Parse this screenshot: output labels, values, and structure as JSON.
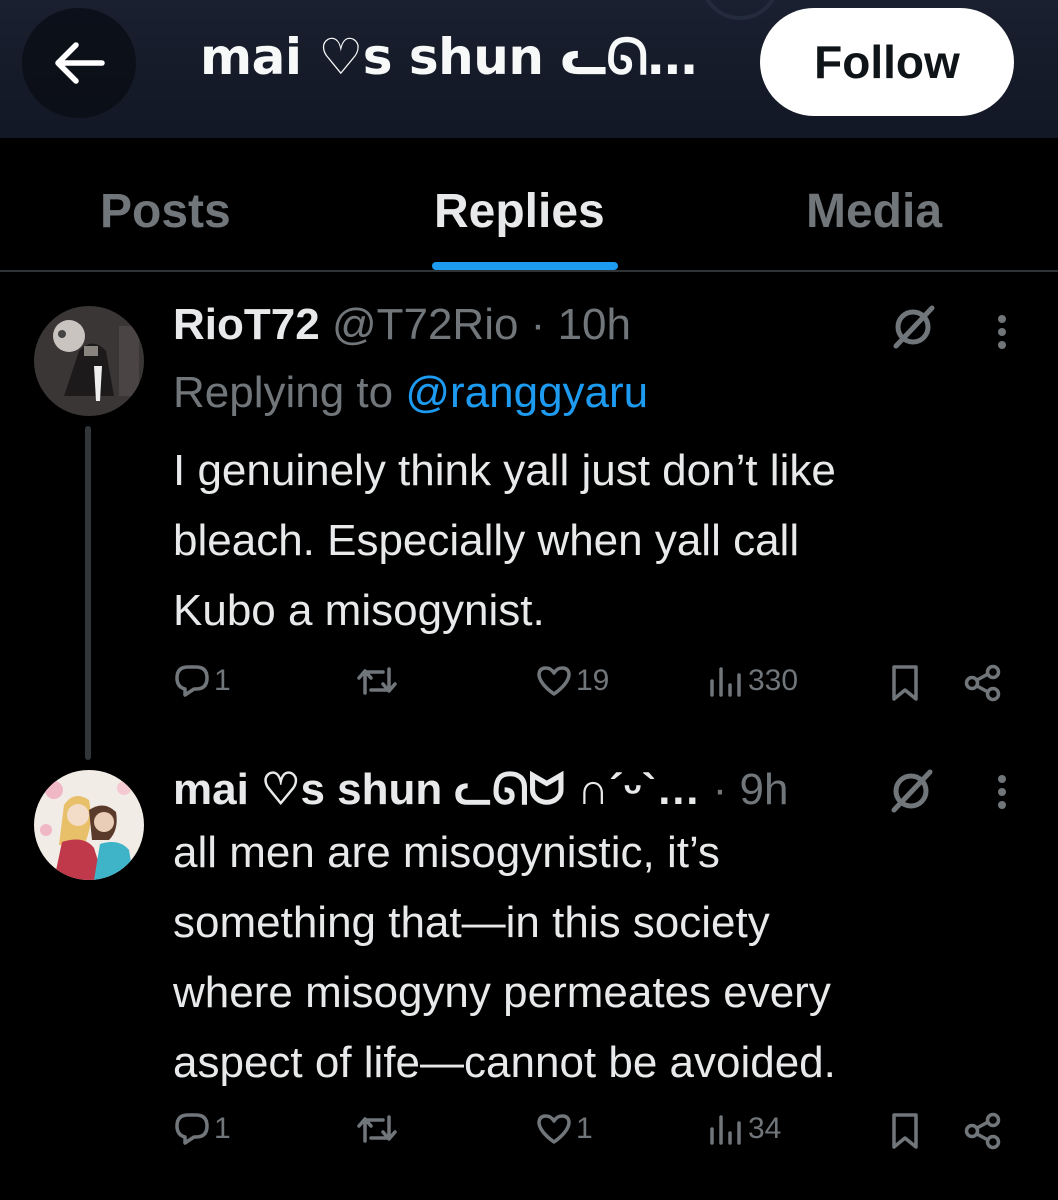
{
  "header": {
    "title": "mai ♡s shun ᓚᘏ…",
    "follow_label": "Follow",
    "back_icon": "arrow-left-icon"
  },
  "tabs": [
    {
      "label": "Posts",
      "active": false
    },
    {
      "label": "Replies",
      "active": true
    },
    {
      "label": "Media",
      "active": false
    }
  ],
  "colors": {
    "accent": "#1d9bf0",
    "background": "#000000",
    "muted": "#71767b"
  },
  "posts": [
    {
      "author_name": "RioT72",
      "handle": "@T72Rio",
      "separator": " · ",
      "time": "10h",
      "replying_prefix": "Replying to ",
      "replying_to": "@ranggyaru",
      "lines": [
        "I genuinely think yall just don’t like",
        "bleach. Especially when yall call",
        "Kubo a misogynist."
      ],
      "stats": {
        "replies": "1",
        "reposts": "",
        "likes": "19",
        "views": "330"
      }
    },
    {
      "author_name": "mai ♡s shun ᓚᘏᗢ ∩´ᵕ`…",
      "separator": " · ",
      "time": "9h",
      "lines": [
        "all men are misogynistic, it’s",
        "something that—in this society",
        "where misogyny permeates every",
        "aspect of life—cannot be avoided."
      ],
      "stats": {
        "replies": "1",
        "reposts": "",
        "likes": "1",
        "views": "34"
      }
    }
  ]
}
